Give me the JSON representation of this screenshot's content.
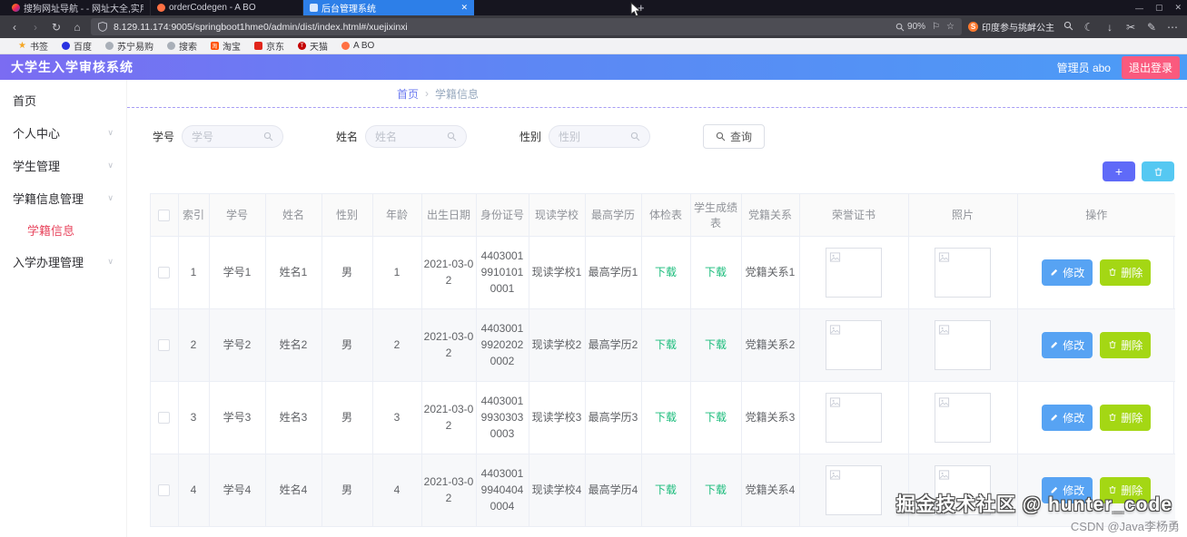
{
  "colors": {
    "header_gradient_start": "#7b6cf2",
    "header_gradient_end": "#4b9cf6",
    "active_tab": "#2d7fe8",
    "active_menu": "#e8475f",
    "breadcrumb_link": "#6d7bf0",
    "breadcrumb_dash": "#a79df5",
    "download_link": "#1abc7b",
    "edit_button": "#57a3f3",
    "delete_button": "#a4d714",
    "add_button": "#5f6af8",
    "batch_delete_button": "#55c8f2",
    "logout_button": "#fa5a7e"
  },
  "browser": {
    "tabs": [
      {
        "title": "搜狗网址导航 - - 网址大全,实用网址"
      },
      {
        "title": "orderCodegen - A BO"
      },
      {
        "title": "后台管理系统"
      }
    ],
    "url": "8.129.11.174:9005/springboot1hme0/admin/dist/index.html#/xuejixinxi",
    "zoom_level": "90%",
    "notification_text": "印度参与挑衅公主",
    "bookmarks_label": "书签",
    "bookmarks": [
      {
        "label": "百度"
      },
      {
        "label": "苏宁易购"
      },
      {
        "label": "搜索"
      },
      {
        "label": "淘宝"
      },
      {
        "label": "京东"
      },
      {
        "label": "天猫"
      },
      {
        "label": "A BO"
      }
    ]
  },
  "app": {
    "title": "大学生入学审核系统",
    "user_label": "管理员 abo",
    "logout_label": "退出登录"
  },
  "sidebar": {
    "items": [
      {
        "label": "首页"
      },
      {
        "label": "个人中心"
      },
      {
        "label": "学生管理"
      },
      {
        "label": "学籍信息管理"
      },
      {
        "label": "学籍信息"
      },
      {
        "label": "入学办理管理"
      }
    ]
  },
  "breadcrumb": {
    "home": "首页",
    "separator": "›",
    "current": "学籍信息"
  },
  "search": {
    "fields": [
      {
        "label": "学号",
        "placeholder": "学号",
        "value": ""
      },
      {
        "label": "姓名",
        "placeholder": "姓名",
        "value": ""
      },
      {
        "label": "性别",
        "placeholder": "性别",
        "value": ""
      }
    ],
    "submit_label": "查询"
  },
  "toolbar": {
    "add_label": "+"
  },
  "table": {
    "columns": [
      "",
      "索引",
      "学号",
      "姓名",
      "性别",
      "年龄",
      "出生日期",
      "身份证号",
      "现读学校",
      "最高学历",
      "体检表",
      "学生成绩表",
      "党籍关系",
      "荣誉证书",
      "照片",
      "操作"
    ],
    "download_label": "下载",
    "edit_label": "修改",
    "delete_label": "删除",
    "rows": [
      {
        "index": "1",
        "student_no": "学号1",
        "name": "姓名1",
        "gender": "男",
        "age": "1",
        "birth": "2021-03-02",
        "id_no": "440300199101010001",
        "school": "现读学校1",
        "degree": "最高学历1",
        "party": "党籍关系1"
      },
      {
        "index": "2",
        "student_no": "学号2",
        "name": "姓名2",
        "gender": "男",
        "age": "2",
        "birth": "2021-03-02",
        "id_no": "440300199202020002",
        "school": "现读学校2",
        "degree": "最高学历2",
        "party": "党籍关系2"
      },
      {
        "index": "3",
        "student_no": "学号3",
        "name": "姓名3",
        "gender": "男",
        "age": "3",
        "birth": "2021-03-02",
        "id_no": "440300199303030003",
        "school": "现读学校3",
        "degree": "最高学历3",
        "party": "党籍关系3"
      },
      {
        "index": "4",
        "student_no": "学号4",
        "name": "姓名4",
        "gender": "男",
        "age": "4",
        "birth": "2021-03-02",
        "id_no": "440300199404040004",
        "school": "现读学校4",
        "degree": "最高学历4",
        "party": "党籍关系4"
      }
    ]
  },
  "watermarks": {
    "line1": "掘金技术社区 @ hunter_code",
    "line2": "CSDN @Java李杨勇"
  }
}
